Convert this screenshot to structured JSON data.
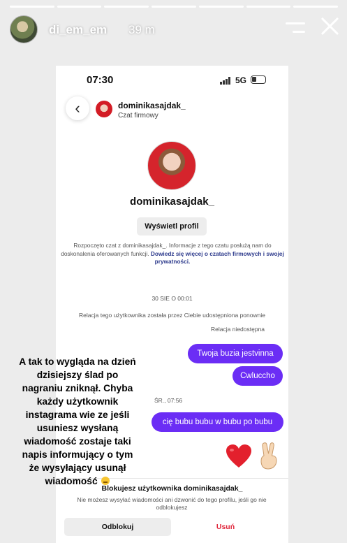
{
  "story": {
    "username": "di_em_em",
    "time_ago": "39 m",
    "progress_segments": 7
  },
  "status_bar": {
    "time": "07:30",
    "network": "5G"
  },
  "chat_header": {
    "username": "dominikasajdak_",
    "subtitle": "Czat firmowy"
  },
  "profile": {
    "username": "dominikasajdak_",
    "view_profile_label": "Wyświetl profil",
    "info_text": "Rozpoczęto czat z dominikasajdak_. Informacje z tego czatu posłużą nam do doskonalenia oferowanych funkcji.",
    "info_link": "Dowiedz się więcej o czatach firmowych i swojej prywatności."
  },
  "conversation": {
    "date_header": "30 SIE O 00:01",
    "share_note": "Relacja tego użytkownika została przez Ciebie udostępniona ponownie",
    "story_unavailable": "Relacja niedostępna",
    "messages": [
      "Twoja buzia jestvinna",
      "Cwluccho",
      "cię bubu bubu w bubu po bubu"
    ],
    "timestamp": "ŚR., 07:56",
    "reactions": [
      "red-heart",
      "victory-hand"
    ]
  },
  "block_panel": {
    "title": "Blokujesz użytkownika dominikasajdak_",
    "description": "Nie możesz wysyłać wiadomości ani dzwonić do tego profilu, jeśli go nie odblokujesz",
    "unblock_label": "Odblokuj",
    "remove_label": "Usuń"
  },
  "caption": {
    "lines": [
      "A tak to wygląda  na dzień",
      "dzisiejszy ślad po",
      "nagraniu  zniknął. Chyba",
      "każdy użytkownik",
      "instagrama wie ze jeśli",
      "usuniesz wysłaną",
      "wiadomość zostaje taki",
      "napis informujący o tym",
      "że wysyłający usunął",
      "wiadomość"
    ]
  }
}
